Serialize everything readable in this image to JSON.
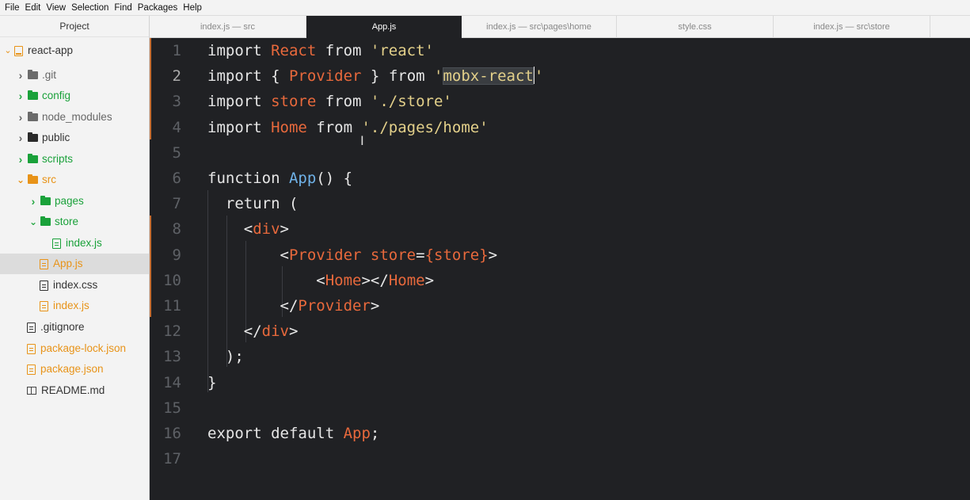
{
  "menu": [
    "File",
    "Edit",
    "View",
    "Selection",
    "Find",
    "Packages",
    "Help"
  ],
  "sidebar": {
    "header": "Project",
    "tree": [
      {
        "label": "react-app",
        "type": "root"
      },
      {
        "label": ".git",
        "type": "folder",
        "color": "gray"
      },
      {
        "label": "config",
        "type": "folder",
        "color": "green"
      },
      {
        "label": "node_modules",
        "type": "folder",
        "color": "gray"
      },
      {
        "label": "public",
        "type": "folder",
        "color": "dark"
      },
      {
        "label": "scripts",
        "type": "folder",
        "color": "green"
      },
      {
        "label": "src",
        "type": "folder",
        "color": "orange",
        "expanded": true
      },
      {
        "label": "pages",
        "type": "folder",
        "color": "green"
      },
      {
        "label": "store",
        "type": "folder",
        "color": "green",
        "expanded": true
      },
      {
        "label": "index.js",
        "type": "file",
        "color": "green"
      },
      {
        "label": "App.js",
        "type": "file",
        "color": "orange",
        "selected": true
      },
      {
        "label": "index.css",
        "type": "file",
        "color": "dark"
      },
      {
        "label": "index.js",
        "type": "file",
        "color": "orange"
      },
      {
        "label": ".gitignore",
        "type": "file",
        "color": "dark"
      },
      {
        "label": "package-lock.json",
        "type": "file",
        "color": "orange"
      },
      {
        "label": "package.json",
        "type": "file",
        "color": "orange"
      },
      {
        "label": "README.md",
        "type": "readme",
        "color": "dark"
      }
    ]
  },
  "tabs": [
    {
      "label": "index.js — src",
      "active": false
    },
    {
      "label": "App.js",
      "active": true
    },
    {
      "label": "index.js — src\\pages\\home",
      "active": false
    },
    {
      "label": "style.css",
      "active": false
    },
    {
      "label": "index.js — src\\store",
      "active": false
    }
  ],
  "editor": {
    "current_line": 2,
    "lines": [
      {
        "n": "1",
        "t": [
          [
            "kw",
            "import "
          ],
          [
            "id",
            "React"
          ],
          [
            "kw",
            " from "
          ],
          [
            "str",
            "'react'"
          ]
        ]
      },
      {
        "n": "2",
        "t": [
          [
            "kw",
            "import "
          ],
          [
            "punc",
            "{ "
          ],
          [
            "id",
            "Provider"
          ],
          [
            "punc",
            " } "
          ],
          [
            "kw",
            "from "
          ],
          [
            "str",
            "'"
          ],
          [
            "str-hl",
            "mobx-react"
          ],
          [
            "cursor",
            ""
          ],
          [
            "str",
            "'"
          ]
        ]
      },
      {
        "n": "3",
        "t": [
          [
            "kw",
            "import "
          ],
          [
            "id",
            "store"
          ],
          [
            "kw",
            " from "
          ],
          [
            "str",
            "'./store'"
          ]
        ]
      },
      {
        "n": "4",
        "t": [
          [
            "kw",
            "import "
          ],
          [
            "id",
            "Home"
          ],
          [
            "kw",
            " from "
          ],
          [
            "str",
            "'./pages/home'"
          ]
        ]
      },
      {
        "n": "5",
        "t": []
      },
      {
        "n": "6",
        "t": [
          [
            "kw",
            "function "
          ],
          [
            "fn",
            "App"
          ],
          [
            "punc",
            "() {"
          ]
        ]
      },
      {
        "n": "7",
        "t": [
          [
            "kw",
            "  return "
          ],
          [
            "punc",
            "("
          ]
        ]
      },
      {
        "n": "8",
        "t": [
          [
            "punc",
            "    <"
          ],
          [
            "tag",
            "div"
          ],
          [
            "punc",
            ">"
          ]
        ]
      },
      {
        "n": "9",
        "t": [
          [
            "punc",
            "        <"
          ],
          [
            "tag",
            "Provider"
          ],
          [
            "attr",
            " store"
          ],
          [
            "punc",
            "="
          ],
          [
            "id",
            "{store}"
          ],
          [
            "punc",
            ">"
          ]
        ]
      },
      {
        "n": "10",
        "t": [
          [
            "punc",
            "            <"
          ],
          [
            "tag",
            "Home"
          ],
          [
            "punc",
            "></"
          ],
          [
            "tag",
            "Home"
          ],
          [
            "punc",
            ">"
          ]
        ]
      },
      {
        "n": "11",
        "t": [
          [
            "punc",
            "        </"
          ],
          [
            "tag",
            "Provider"
          ],
          [
            "punc",
            ">"
          ]
        ]
      },
      {
        "n": "12",
        "t": [
          [
            "punc",
            "    </"
          ],
          [
            "tag",
            "div"
          ],
          [
            "punc",
            ">"
          ]
        ]
      },
      {
        "n": "13",
        "t": [
          [
            "punc",
            "  );"
          ]
        ]
      },
      {
        "n": "14",
        "t": [
          [
            "punc",
            "}"
          ]
        ]
      },
      {
        "n": "15",
        "t": []
      },
      {
        "n": "16",
        "t": [
          [
            "kw",
            "export default "
          ],
          [
            "id",
            "App"
          ],
          [
            "punc",
            ";"
          ]
        ]
      },
      {
        "n": "17",
        "t": []
      }
    ]
  }
}
